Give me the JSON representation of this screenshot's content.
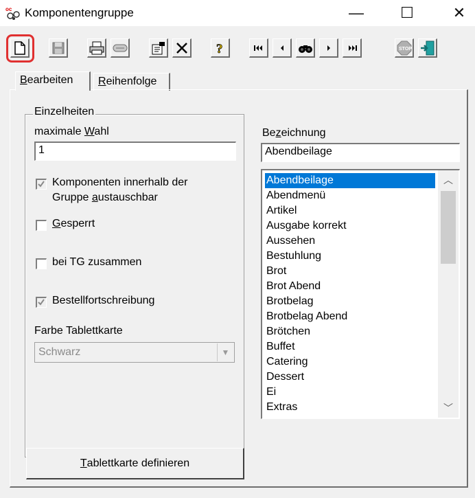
{
  "window": {
    "title": "Komponentengruppe"
  },
  "caption": {
    "min": "—",
    "max": "☐",
    "close": "✕"
  },
  "tabs": [
    {
      "label": "Bearbeiten",
      "mnemonic": "B",
      "rest": "earbeiten"
    },
    {
      "label": "Reihenfolge",
      "mnemonic": "R",
      "rest": "eihenfolge"
    }
  ],
  "group": {
    "legend": "Einzelheiten",
    "max_label_pre": "maximale ",
    "max_label_mn": "W",
    "max_label_post": "ahl",
    "max_value": "1",
    "chk_austausch_line1": "Komponenten innerhalb der",
    "chk_austausch_line2_pre": "Gruppe ",
    "chk_austausch_line2_mn": "a",
    "chk_austausch_line2_post": "ustauschbar",
    "chk_gesperrt_mn": "G",
    "chk_gesperrt_rest": "esperrt",
    "chk_tg": "bei TG zusammen",
    "chk_bestell": "Bestellfortschreibung",
    "farbe_label": "Farbe Tablettkarte",
    "farbe_value": "Schwarz"
  },
  "bezeichnung": {
    "label_pre": "Be",
    "label_mn": "z",
    "label_post": "eichnung",
    "value": "Abendbeilage"
  },
  "list": {
    "selected": "Abendbeilage",
    "items": [
      "Abendbeilage",
      "Abendmenü",
      "Artikel",
      "Ausgabe korrekt",
      "Aussehen",
      "Bestuhlung",
      "Brot",
      "Brot Abend",
      "Brotbelag",
      "Brotbelag Abend",
      "Brötchen",
      "Buffet",
      "Catering",
      "Dessert",
      "Ei",
      "Extras"
    ]
  },
  "define_button": {
    "mn": "T",
    "rest": "ablettkarte definieren"
  },
  "toolbar": {
    "buttons": [
      "new-icon",
      "save-icon",
      "print-icon",
      "tape-icon",
      "properties-icon",
      "delete-icon",
      "help-icon",
      "first-icon",
      "prev-icon",
      "find-icon",
      "next-icon",
      "last-icon",
      "stop-icon",
      "exit-icon"
    ]
  },
  "colors": {
    "selection": "#0078d7",
    "highlight_ring": "#e03030"
  }
}
